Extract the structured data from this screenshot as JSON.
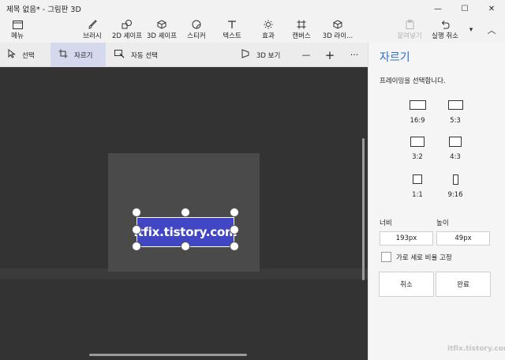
{
  "window": {
    "title": "제목 없음* - 그림판 3D",
    "minimize_glyph": "—",
    "maximize_glyph": "☐",
    "close_glyph": "✕"
  },
  "ribbon": {
    "menu": {
      "label": "메뉴",
      "icon": "folder-icon"
    },
    "tools": [
      {
        "label": "브러시",
        "icon": "brush-icon"
      },
      {
        "label": "2D 셰이프",
        "icon": "2d-shapes-icon"
      },
      {
        "label": "3D 셰이프",
        "icon": "3d-shapes-icon"
      },
      {
        "label": "스티커",
        "icon": "stickers-icon"
      },
      {
        "label": "텍스트",
        "icon": "text-icon"
      },
      {
        "label": "효과",
        "icon": "effects-icon"
      },
      {
        "label": "캔버스",
        "icon": "canvas-icon"
      },
      {
        "label": "3D 라이...",
        "icon": "3d-library-icon"
      }
    ],
    "paste": {
      "label": "붙여넣기",
      "icon": "paste-icon",
      "disabled": true
    },
    "undo": {
      "label": "실행 취소",
      "icon": "undo-icon"
    },
    "more_glyph": "▾",
    "collapse_glyph": "︿"
  },
  "toolbar": {
    "select": {
      "label": "선택",
      "icon": "cursor-icon"
    },
    "crop": {
      "label": "자르기",
      "icon": "crop-icon",
      "active": true
    },
    "magic_select": {
      "label": "자동 선택",
      "icon": "magic-select-icon"
    },
    "view3d": {
      "label": "3D 보기",
      "icon": "3d-view-icon"
    },
    "zoom_out_glyph": "—",
    "zoom_in_glyph": "+",
    "more_glyph": "···"
  },
  "canvas": {
    "text": "itfix.tistory.com",
    "text_background": "#4147c4",
    "workspace_color": "#333333",
    "board_color": "#4a4a4a"
  },
  "panel": {
    "title": "자르기",
    "accent": "#2b6dcd",
    "prompt": "프레이밍을 선택합니다.",
    "ratios": [
      {
        "label": "16:9"
      },
      {
        "label": "5:3"
      },
      {
        "label": "3:2"
      },
      {
        "label": "4:3"
      },
      {
        "label": "1:1"
      },
      {
        "label": "9:16"
      }
    ],
    "width_label": "너비",
    "width_value": "193px",
    "height_label": "높이",
    "height_value": "49px",
    "lock_label": "가로 세로 비율 고정",
    "lock_checked": false,
    "cancel_label": "취소",
    "done_label": "완료",
    "watermark": "itfix.tistory.com"
  }
}
